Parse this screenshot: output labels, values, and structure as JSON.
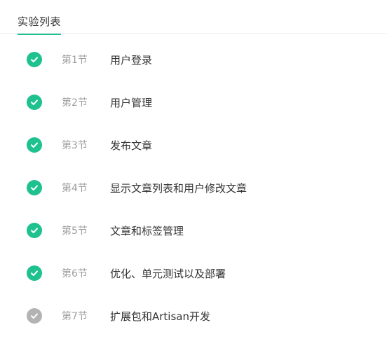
{
  "header": {
    "tab_label": "实验列表"
  },
  "colors": {
    "accent": "#20c193",
    "done": "#1fc18f",
    "todo": "#b3b3b3"
  },
  "items": [
    {
      "section": "第1节",
      "title": "用户登录",
      "status": "done",
      "icon": "check-circle-icon"
    },
    {
      "section": "第2节",
      "title": "用户管理",
      "status": "done",
      "icon": "check-circle-icon"
    },
    {
      "section": "第3节",
      "title": "发布文章",
      "status": "done",
      "icon": "check-circle-icon"
    },
    {
      "section": "第4节",
      "title": "显示文章列表和用户修改文章",
      "status": "done",
      "icon": "check-circle-icon"
    },
    {
      "section": "第5节",
      "title": "文章和标签管理",
      "status": "done",
      "icon": "check-circle-icon"
    },
    {
      "section": "第6节",
      "title": "优化、单元测试以及部署",
      "status": "done",
      "icon": "check-circle-icon"
    },
    {
      "section": "第7节",
      "title": "扩展包和Artisan开发",
      "status": "todo",
      "icon": "check-circle-icon"
    }
  ]
}
